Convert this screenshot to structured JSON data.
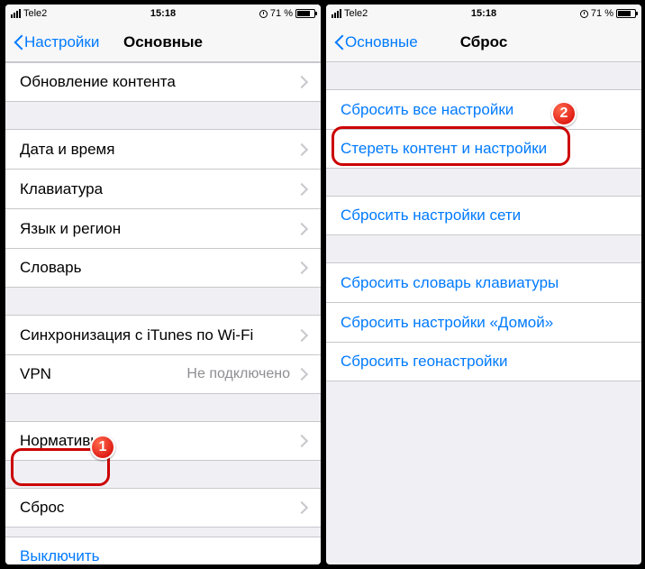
{
  "status": {
    "carrier": "Tele2",
    "time": "15:18",
    "battery_text": "71 %"
  },
  "left": {
    "back": "Настройки",
    "title": "Основные",
    "rows": {
      "content_update": "Обновление контента",
      "date_time": "Дата и время",
      "keyboard": "Клавиатура",
      "language": "Язык и регион",
      "dictionary": "Словарь",
      "itunes_sync": "Синхронизация с iTunes по Wi-Fi",
      "vpn": "VPN",
      "vpn_status": "Не подключено",
      "norm": "Нормативы",
      "reset": "Сброс",
      "shutdown": "Выключить"
    }
  },
  "right": {
    "back": "Основные",
    "title": "Сброс",
    "rows": {
      "reset_all": "Сбросить все настройки",
      "erase": "Стереть контент и настройки",
      "reset_network": "Сбросить настройки сети",
      "reset_dict": "Сбросить словарь клавиатуры",
      "reset_home": "Сбросить настройки «Домой»",
      "reset_geo": "Сбросить геонастройки"
    }
  },
  "badges": {
    "one": "1",
    "two": "2"
  }
}
